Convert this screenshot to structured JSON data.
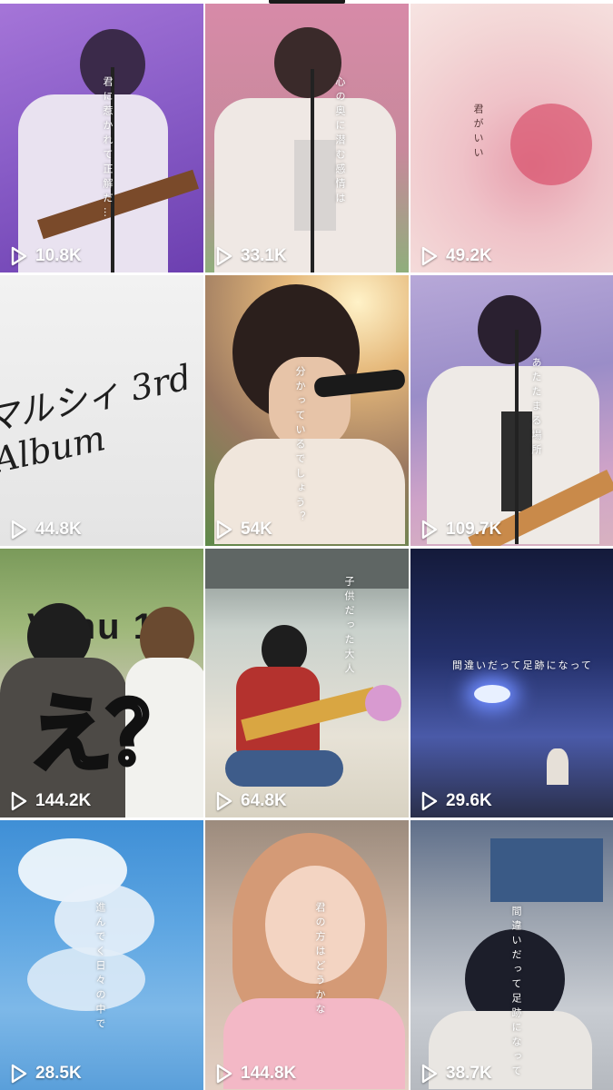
{
  "videos": [
    {
      "views": "10.8K",
      "caption": "君に惹かれて正解だ…"
    },
    {
      "views": "33.1K",
      "caption": "心の奥に潜む感情は"
    },
    {
      "views": "49.2K",
      "caption": "君がいい"
    },
    {
      "views": "44.8K",
      "caption": "マルシィ 3rd Album"
    },
    {
      "views": "54K",
      "caption": "分かっているでしょう？"
    },
    {
      "views": "109.7K",
      "caption": "あたたまる場所"
    },
    {
      "views": "144.2K",
      "caption": "え？",
      "sign": "Venu 1"
    },
    {
      "views": "64.8K",
      "caption": "子供だった大人"
    },
    {
      "views": "29.6K",
      "caption": "間違いだって足跡になって"
    },
    {
      "views": "28.5K",
      "caption": "進んでく日々の中で"
    },
    {
      "views": "144.8K",
      "caption": "君の方はどうかな"
    },
    {
      "views": "38.7K",
      "caption": "間違いだって足跡になって"
    }
  ],
  "icons": {
    "play": "play-outline-icon"
  },
  "colors": {
    "views_text": "#ffffff",
    "status_bar": "#1a1a1a"
  }
}
